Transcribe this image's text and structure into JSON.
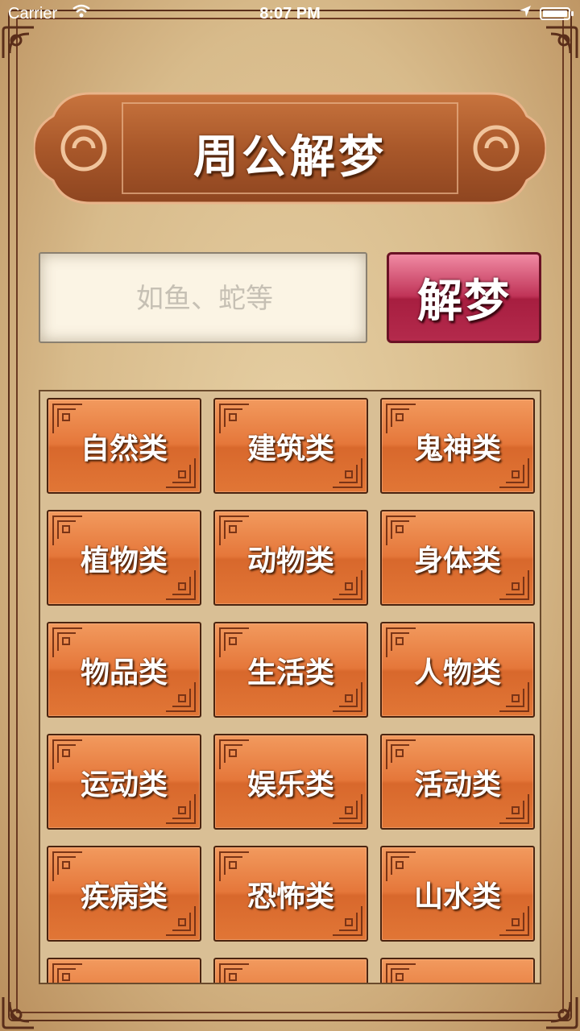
{
  "status_bar": {
    "carrier": "Carrier",
    "time": "8:07 PM"
  },
  "header": {
    "title": "周公解梦"
  },
  "search": {
    "placeholder": "如鱼、蛇等",
    "button_label": "解梦"
  },
  "categories": [
    "自然类",
    "建筑类",
    "鬼神类",
    "植物类",
    "动物类",
    "身体类",
    "物品类",
    "生活类",
    "人物类",
    "运动类",
    "娱乐类",
    "活动类",
    "疾病类",
    "恐怖类",
    "山水类",
    "",
    "",
    ""
  ],
  "colors": {
    "tile": "#e5773a",
    "search_button": "#b42a4c",
    "banner": "#a9582a",
    "frame": "#5a2e1a"
  }
}
